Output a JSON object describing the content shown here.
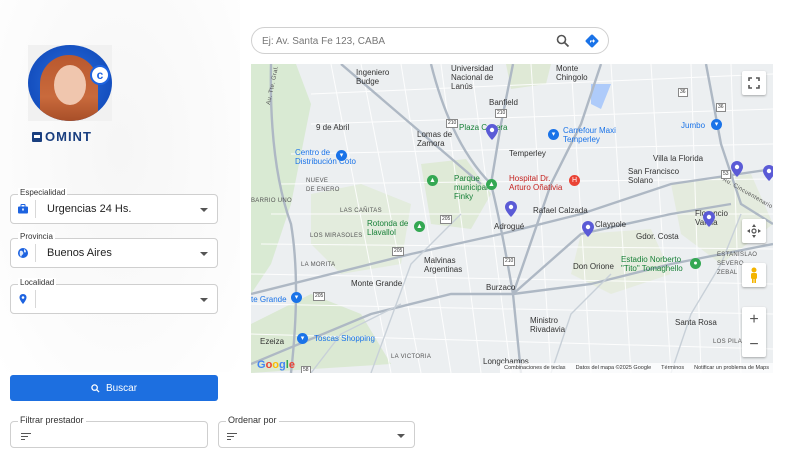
{
  "profile": {
    "logo_text": "OMINT"
  },
  "form": {
    "especialidad": {
      "label": "Especialidad",
      "value": "Urgencias 24 Hs.",
      "icon": "briefcase-icon"
    },
    "provincia": {
      "label": "Provincia",
      "value": "Buenos Aires",
      "icon": "globe-icon"
    },
    "localidad": {
      "label": "Localidad",
      "value": "",
      "icon": "location-pin-icon"
    },
    "search_button": "Buscar",
    "filtrar": {
      "label": "Filtrar prestador"
    },
    "ordenar": {
      "label": "Ordenar por"
    }
  },
  "map_search": {
    "placeholder": "Ej: Av. Santa Fe 123, CABA"
  },
  "map": {
    "labels": {
      "ingeniero_budge": "Ingeniero\nBudge",
      "universidad": "Universidad\nNacional de\nLanús",
      "monte_chingolo": "Monte\nChingolo",
      "banfield": "Banfield",
      "nueve_abril": "9 de Abril",
      "lomas": "Lomas de\nZamora",
      "plaza_canera": "Plaza Canera",
      "carrefour": "Carrefour Maxi\nTemperley",
      "jumbo": "Jumbo",
      "centro_dist": "Centro de\nDistribución Coto",
      "temperley": "Temperley",
      "villa_florida": "Villa la Florida",
      "parque": "Parque\nmunicipal\nFinky",
      "hospital": "Hospital Dr.\nArturo Oñativia",
      "san_francisco": "San Francisco\nSolano",
      "nueve_enero": "NUEVE\nDE ENERO",
      "barrio_uno": "BARRIO UNO",
      "las_canitas": "LAS CAÑITAS",
      "rafael_calzada": "Rafael Calzada",
      "florencio": "Florencio\nVarela",
      "rotonda": "Rotonda de\nLlavallol",
      "los_mirasoles": "LOS MIRASOLES",
      "adrogue": "Adrogué",
      "claypole": "Claypole",
      "gdor_costa": "Gdor. Costa",
      "la_morita": "LA MORITA",
      "malvinas": "Malvinas\nArgentinas",
      "don_orione": "Don Orione",
      "estadio": "Estadio Norberto\n\"Tito\" Tomaghello",
      "estanislao": "ESTANISLAO\nSEVERO\nZEBAL",
      "monte_grande": "Monte Grande",
      "burzaco": "Burzaco",
      "te_grande": "te Grande",
      "ministro": "Ministro\nRivadavia",
      "santa_rosa": "Santa Rosa",
      "ezeiza": "Ezeiza",
      "toscas": "Toscas Shopping",
      "la_victoria": "LA VICTORIA",
      "longchamps": "Longchamps",
      "los_pilares": "LOS PILARES",
      "road_ricchieri": "Au. Tte. Gral. Pablo Riccheri",
      "road_cincuentenario": "Au. Cincuentenario",
      "road_rotonda": "Camino de Cintura",
      "road_provincial": "Provincial Rd"
    },
    "shields": [
      "210",
      "205",
      "205",
      "210",
      "205",
      "53",
      "58",
      "36",
      "36",
      "210"
    ],
    "attribution": {
      "shortcuts": "Combinaciones de teclas",
      "data": "Datos del mapa ©2025 Google",
      "terms": "Términos",
      "report": "Notificar un problema de Maps"
    },
    "google": "Google"
  }
}
